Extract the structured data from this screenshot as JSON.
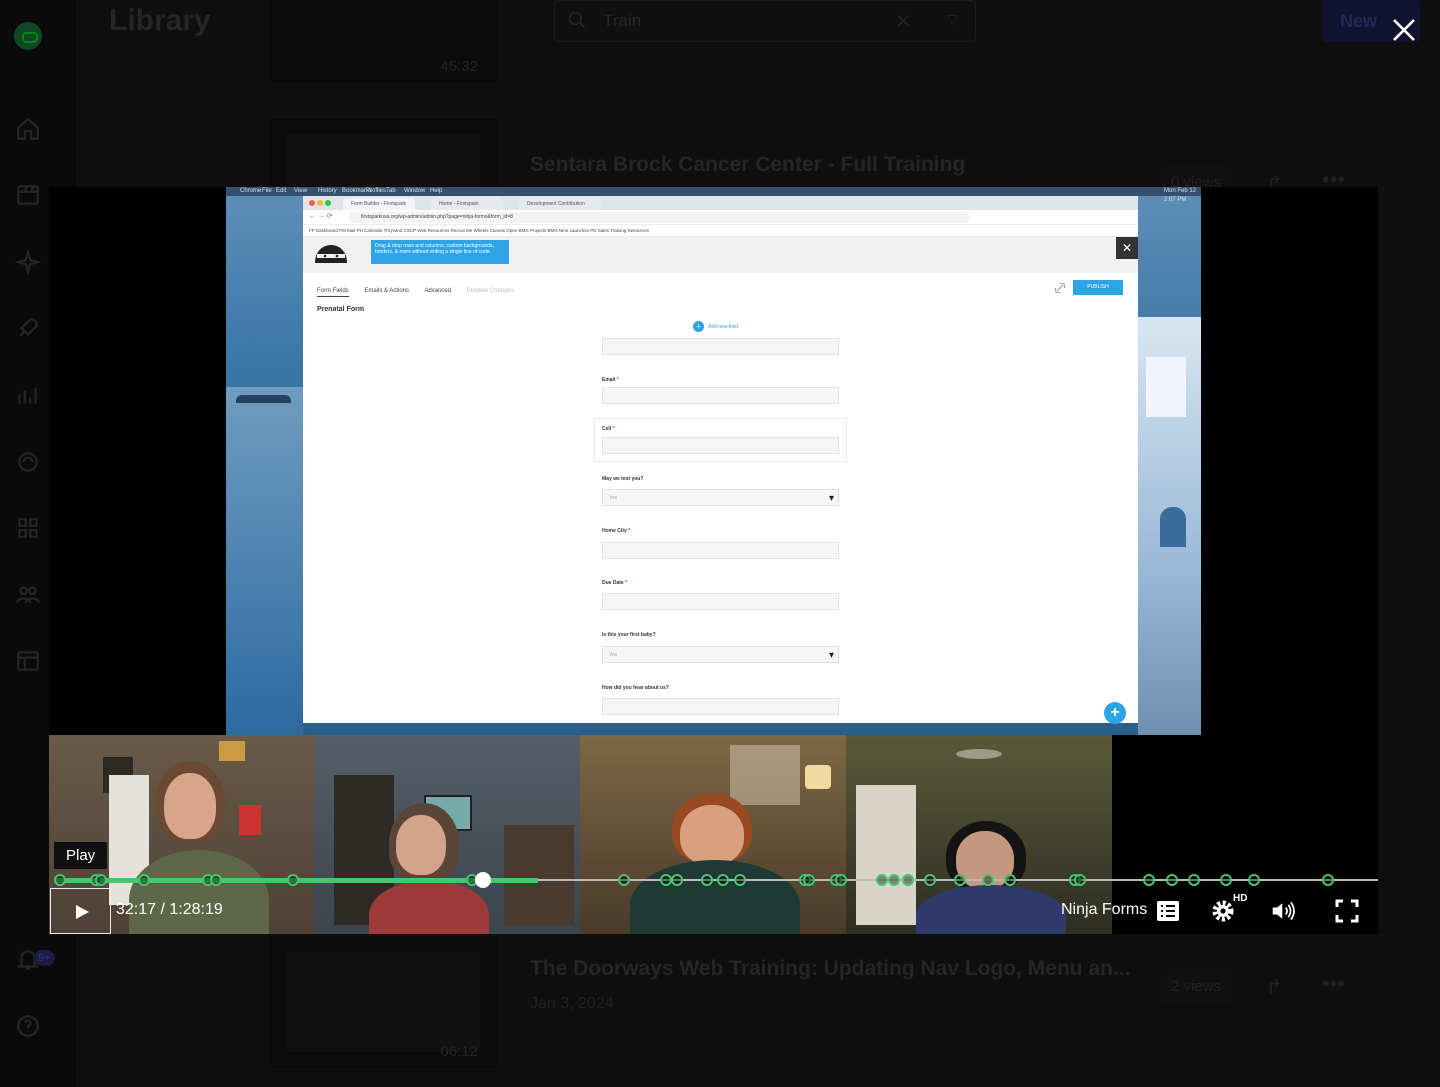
{
  "library": {
    "title": "Library",
    "search_value": "Train",
    "new_label": "New",
    "notif_badge": "9+"
  },
  "rows": [
    {
      "duration": "45:32"
    },
    {
      "title": "Sentara Brock Cancer Center - Full Training",
      "views": "0 views"
    },
    {
      "title": "The Doorways Web Training: Updating Nav Logo, Menu an...",
      "date": "Jan 3, 2024",
      "views": "2 views",
      "duration": "06:12"
    }
  ],
  "screen": {
    "menubar": [
      "Chrome",
      "File",
      "Edit",
      "View",
      "History",
      "Bookmarks",
      "Profiles",
      "Tab",
      "Window",
      "Help"
    ],
    "menubar_right": "Mon Feb 12 2:07 PM",
    "tabs": [
      "Form Builder - Firstspark",
      "Home - Firstspark",
      "Development Contribution"
    ],
    "url": "firstsparkusa.org/wp-admin/admin.php?page=ninja-forms&form_id=8",
    "bookmarks": "FP Dashboard   PM Mail   PH Calendar   Thryvand   CSCP Web   Resources   Recruit Me   Wheels   Canvas   Open BMG Projects   BMG Nine Launches   PD Sales Training   Resources",
    "tooltip": "Drag & drop rows and columns, custom backgrounds, borders, & more without writing a single line of code.",
    "nf_tabs": [
      "Form Fields",
      "Emails & Actions",
      "Advanced",
      "Preview Changes"
    ],
    "publish": "PUBLISH",
    "form_name": "Prenatal Form",
    "add_field": "Add new field",
    "fields": {
      "email": "Email",
      "cell": "Cell",
      "text_q": "May we text you?",
      "text_val": "Yes",
      "city": "Home City",
      "due": "Due Date",
      "first_baby": "Is this your first baby?",
      "first_baby_val": "Yes",
      "hear": "How did you hear about us?"
    },
    "req": "*"
  },
  "player": {
    "play_tooltip": "Play",
    "time_current": "32:17",
    "time_sep": " / ",
    "time_total": "1:28:19",
    "chapter": "Ninja Forms",
    "hd": "HD",
    "progress": 0.3654,
    "markers": [
      0.004,
      0.031,
      0.035,
      0.067,
      0.116,
      0.122,
      0.18,
      0.315,
      0.322,
      0.43,
      0.462,
      0.47,
      0.493,
      0.505,
      0.518,
      0.567,
      0.57,
      0.59,
      0.594,
      0.625,
      0.634,
      0.645,
      0.661,
      0.684,
      0.705,
      0.722,
      0.771,
      0.775,
      0.827,
      0.844,
      0.861,
      0.885,
      0.906,
      0.962
    ]
  }
}
